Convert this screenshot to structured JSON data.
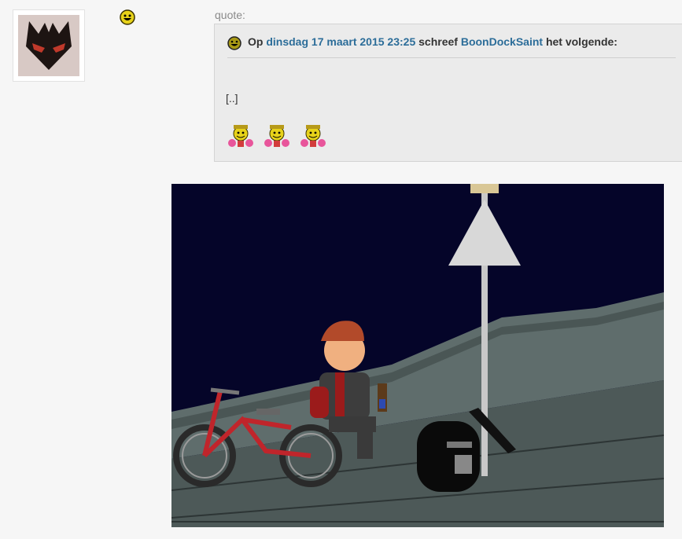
{
  "post": {
    "avatar": {
      "icon": "bat-mask-avatar-icon"
    },
    "status_smiley": {
      "icon": "smiley-icon"
    },
    "quote_label": "quote:",
    "quote": {
      "prefix": "Op",
      "date_link": "dinsdag 17 maart 2015 23:25",
      "middle": "schreef",
      "author_link": "BoonDockSaint",
      "suffix": "het volgende:",
      "body": "[..]",
      "emotes": [
        "cheerleader-smiley-icon",
        "cheerleader-smiley-icon",
        "cheerleader-smiley-icon"
      ]
    },
    "image": {
      "description_icon": "comic-image"
    }
  },
  "colors": {
    "link": "#2c6d99",
    "night_sky": "#050529",
    "quote_bg": "#ebebeb"
  }
}
